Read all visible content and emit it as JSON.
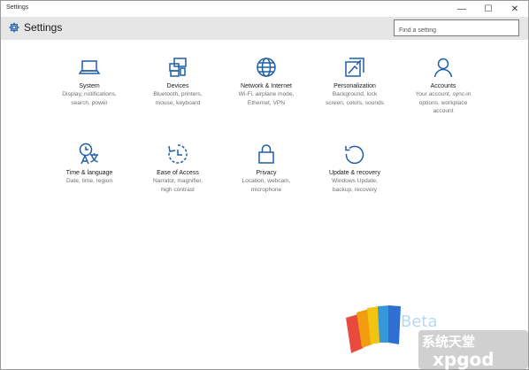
{
  "window": {
    "title": "Settings",
    "minimize_glyph": "—",
    "maximize_glyph": "☐",
    "close_glyph": "✕"
  },
  "header": {
    "title": "Settings",
    "icon": "gear-icon"
  },
  "search": {
    "placeholder": "Find a setting"
  },
  "tiles": [
    {
      "id": "system",
      "icon": "laptop-icon",
      "name": "System",
      "desc": "Display, notifications,\nsearch, power"
    },
    {
      "id": "devices",
      "icon": "devices-icon",
      "name": "Devices",
      "desc": "Bluetooth, printers,\nmouse, keyboard"
    },
    {
      "id": "network",
      "icon": "globe-icon",
      "name": "Network & Internet",
      "desc": "Wi-Fi, airplane mode,\nEthernet, VPN"
    },
    {
      "id": "personalization",
      "icon": "paintbrush-icon",
      "name": "Personalization",
      "desc": "Background, lock\nscreen, colors, sounds"
    },
    {
      "id": "accounts",
      "icon": "person-icon",
      "name": "Accounts",
      "desc": "Your account, sync-in\noptions, workplace\naccount"
    },
    {
      "id": "time-language",
      "icon": "time-language-icon",
      "name": "Time & language",
      "desc": "Date, time, region"
    },
    {
      "id": "ease-of-access",
      "icon": "ease-of-access-icon",
      "name": "Ease of Access",
      "desc": "Narrator, magnifier,\nhigh contrast"
    },
    {
      "id": "privacy",
      "icon": "lock-icon",
      "name": "Privacy",
      "desc": "Location, webcam,\nmicrophone"
    },
    {
      "id": "update-recovery",
      "icon": "refresh-icon",
      "name": "Update & recovery",
      "desc": "Windows Update,\nbackup, recovery"
    }
  ],
  "watermark": {
    "beta_text": "Beta",
    "site_text": "系统天堂",
    "domain_text": "xpgod",
    "colors": [
      "#e84a3b",
      "#f39c12",
      "#f1c40f",
      "#3498db",
      "#2e6fd1"
    ]
  },
  "colors": {
    "accent": "#1f5fa8",
    "header_bg": "#e6e6e6",
    "description_text": "#707070"
  }
}
